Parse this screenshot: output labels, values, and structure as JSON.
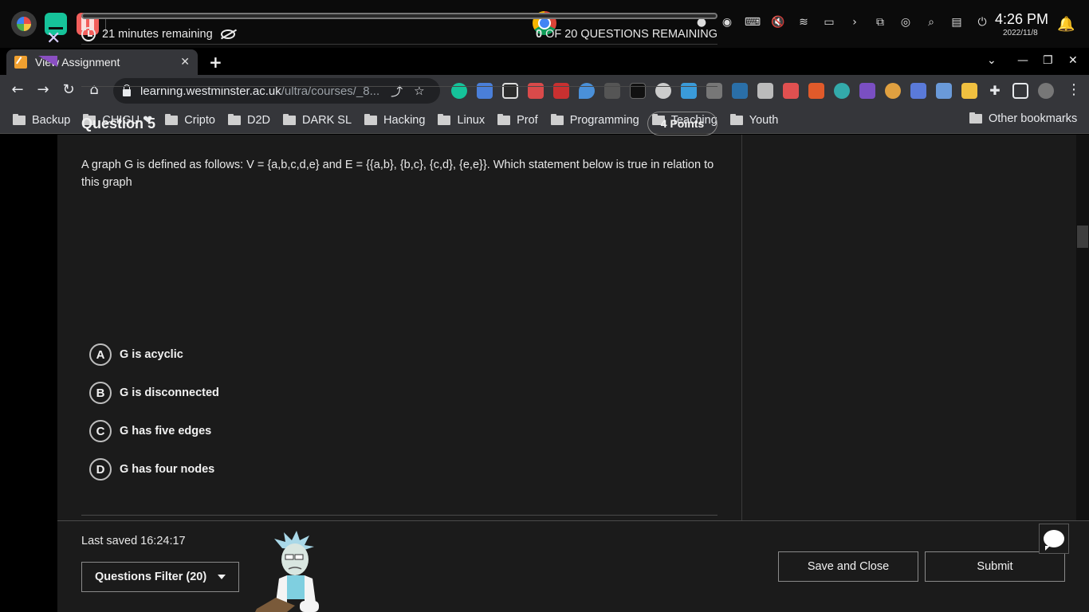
{
  "os": {
    "time": "4:26 PM",
    "date": "2022/11/8"
  },
  "browser": {
    "tab_title": "View Assignment",
    "tab_close": "✕",
    "new_tab": "+",
    "url_host": "learning.westminster.ac.uk",
    "url_path": "/ultra/courses/_8...",
    "bookmarks": [
      "Backup",
      "CHIGU ❤",
      "Cripto",
      "D2D",
      "DARK SL",
      "Hacking",
      "Linux",
      "Prof",
      "Programming",
      "Teaching",
      "Youth"
    ],
    "other_bookmarks": "Other bookmarks"
  },
  "assessment": {
    "close": "✕",
    "time_remaining": "21 minutes remaining",
    "questions_remaining_count": "0",
    "questions_remaining_label": " OF 20 QUESTIONS REMAINING",
    "progress_fraction": 1.0
  },
  "question": {
    "title": "Question 5",
    "points": "4 Points",
    "text": "A graph G is defined as follows: V = {a,b,c,d,e} and E = {{a,b}, {b,c}, {c,d}, {e,e}}. Which statement below is true in relation to this graph",
    "options": [
      {
        "letter": "A",
        "text": "G is acyclic"
      },
      {
        "letter": "B",
        "text": "G is disconnected"
      },
      {
        "letter": "C",
        "text": "G has five edges"
      },
      {
        "letter": "D",
        "text": "G has four nodes"
      }
    ]
  },
  "footer": {
    "last_saved": "Last saved 16:24:17",
    "filter": "Questions Filter (20)",
    "save_close": "Save and Close",
    "submit": "Submit"
  },
  "colors": {
    "accent": "#8a4fc2",
    "background": "#1b1b1b",
    "text": "#f1f1f1"
  }
}
